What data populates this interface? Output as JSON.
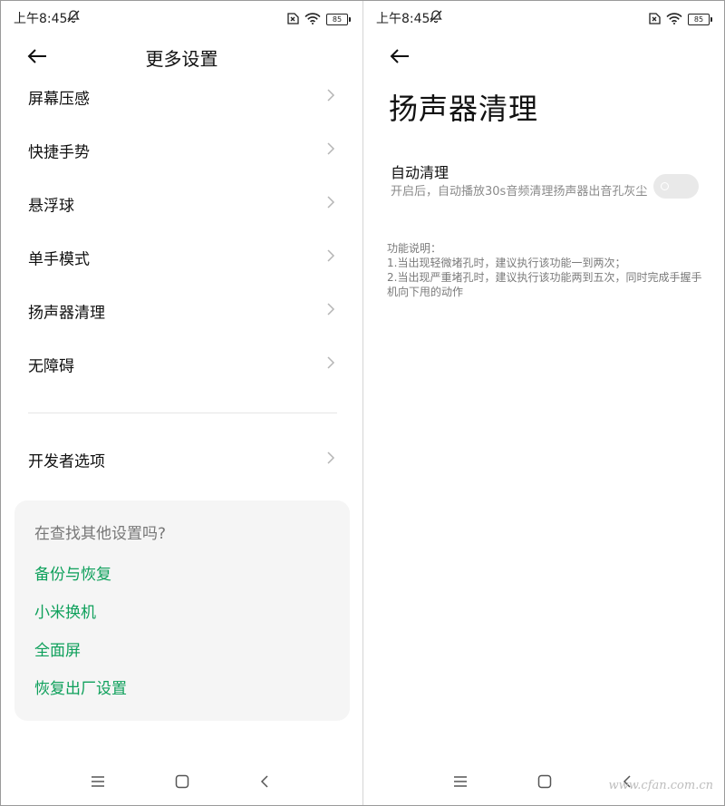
{
  "left": {
    "status": {
      "time": "上午8:45",
      "battery": "85"
    },
    "title": "更多设置",
    "items": [
      {
        "label": "屏幕压感"
      },
      {
        "label": "快捷手势"
      },
      {
        "label": "悬浮球"
      },
      {
        "label": "单手模式"
      },
      {
        "label": "扬声器清理"
      },
      {
        "label": "无障碍"
      },
      {
        "label": "开发者选项"
      }
    ],
    "suggest": {
      "title": "在查找其他设置吗?",
      "links": [
        {
          "label": "备份与恢复"
        },
        {
          "label": "小米换机"
        },
        {
          "label": "全面屏"
        },
        {
          "label": "恢复出厂设置"
        }
      ]
    }
  },
  "right": {
    "status": {
      "time": "上午8:45",
      "battery": "85"
    },
    "title": "扬声器清理",
    "option": {
      "title": "自动清理",
      "desc": "开启后，自动播放30s音频清理扬声器出音孔灰尘",
      "enabled": false
    },
    "notes": [
      "功能说明：",
      "1.当出现轻微堵孔时，建议执行该功能一到两次；",
      "2.当出现严重堵孔时，建议执行该功能两到五次，同时完成手握手机向下甩的动作"
    ]
  },
  "watermark": "www.cfan.com.cn",
  "colors": {
    "accent": "#0ea05b",
    "toggle_off": "#e9e9e9",
    "card_bg": "#f5f5f5"
  }
}
